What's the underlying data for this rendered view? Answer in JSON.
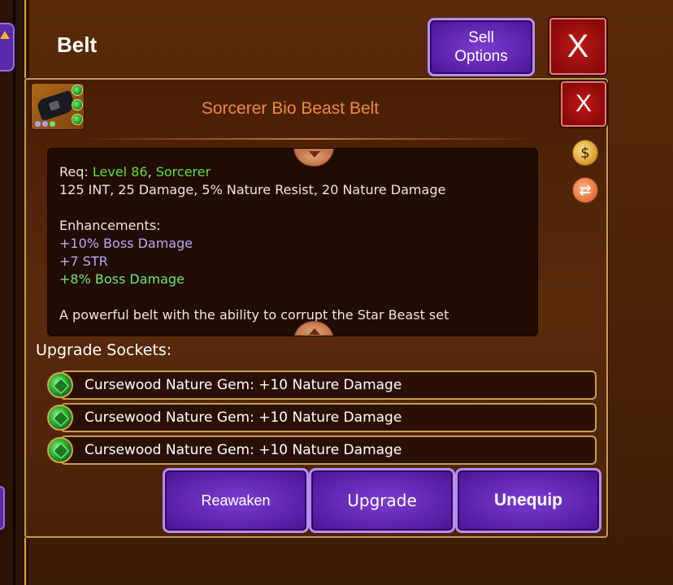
{
  "background": {
    "title": "Belt",
    "sell_button_line1": "Sell",
    "sell_button_line2": "Options",
    "close_label": "X"
  },
  "item": {
    "name": "Sorcerer Bio Beast Belt",
    "close_label": "X",
    "req_prefix": "Req: ",
    "req_level": "Level 86",
    "req_sep": ", ",
    "req_class": "Sorcerer",
    "stats": "125 INT, 25 Damage, 5% Nature Resist, 20 Nature Damage",
    "enhancements_label": "Enhancements:",
    "enhancements": [
      "+10% Boss Damage",
      "+7 STR",
      "+8% Boss Damage"
    ],
    "description": "A powerful belt with the ability to corrupt the Star Beast set"
  },
  "sockets": {
    "label": "Upgrade Sockets:",
    "items": [
      "Cursewood Nature Gem: +10 Nature Damage",
      "Cursewood Nature Gem: +10 Nature Damage",
      "Cursewood Nature Gem: +10 Nature Damage"
    ]
  },
  "actions": {
    "reawaken": "Reawaken",
    "upgrade": "Upgrade",
    "unequip": "Unequip"
  },
  "colors": {
    "title_orange": "#f08a3c",
    "req_green": "#5fe03a",
    "enh_purple": "#b8a8f8",
    "enh_green": "#6ee87a",
    "button_purple": "#5a1fa8",
    "close_red": "#c01818"
  },
  "icons": {
    "item": "belt-icon",
    "bag": "coin-bag-icon",
    "swap": "swap-icon",
    "gem": "nature-gem-icon"
  }
}
